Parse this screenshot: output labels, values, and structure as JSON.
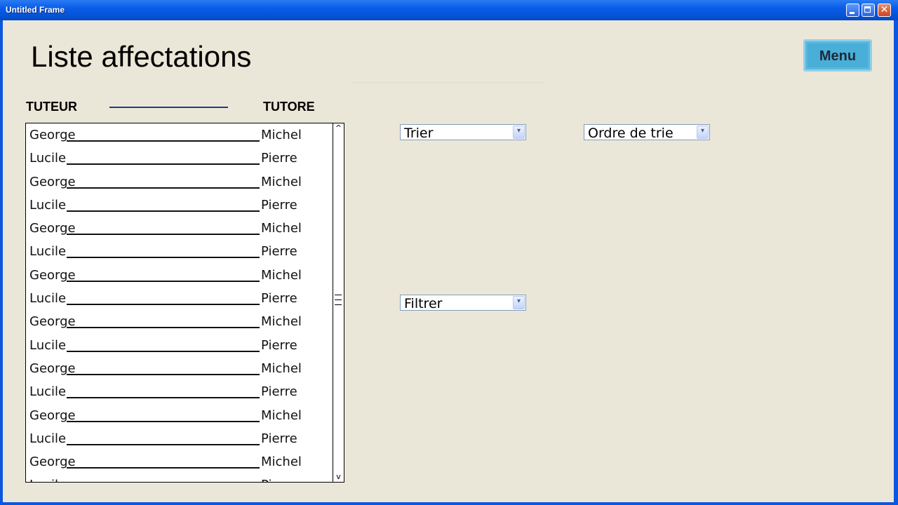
{
  "window": {
    "title": "Untitled Frame"
  },
  "page": {
    "title": "Liste affectations"
  },
  "header": {
    "menu_label": "Menu"
  },
  "columns": {
    "tuteur": "TUTEUR",
    "tutore": "TUTORE"
  },
  "list": {
    "items": [
      {
        "tuteur": "George",
        "tutore": "Michel"
      },
      {
        "tuteur": "Lucile",
        "tutore": "Pierre"
      },
      {
        "tuteur": "George",
        "tutore": "Michel"
      },
      {
        "tuteur": "Lucile",
        "tutore": "Pierre"
      },
      {
        "tuteur": "George",
        "tutore": "Michel"
      },
      {
        "tuteur": "Lucile",
        "tutore": "Pierre"
      },
      {
        "tuteur": "George",
        "tutore": "Michel"
      },
      {
        "tuteur": "Lucile",
        "tutore": "Pierre"
      },
      {
        "tuteur": "George",
        "tutore": "Michel"
      },
      {
        "tuteur": "Lucile",
        "tutore": "Pierre"
      },
      {
        "tuteur": "George",
        "tutore": "Michel"
      },
      {
        "tuteur": "Lucile",
        "tutore": "Pierre"
      },
      {
        "tuteur": "George",
        "tutore": "Michel"
      },
      {
        "tuteur": "Lucile",
        "tutore": "Pierre"
      },
      {
        "tuteur": "George",
        "tutore": "Michel"
      },
      {
        "tuteur": "Lucile",
        "tutore": "Pierre"
      }
    ]
  },
  "controls": {
    "sort_value": "Trier",
    "order_value": "Ordre de trie",
    "filter_value": "Filtrer"
  },
  "colors": {
    "titlebar": "#0a5ce8",
    "background": "#ebe7d8",
    "menu_button": "#49aed8"
  }
}
